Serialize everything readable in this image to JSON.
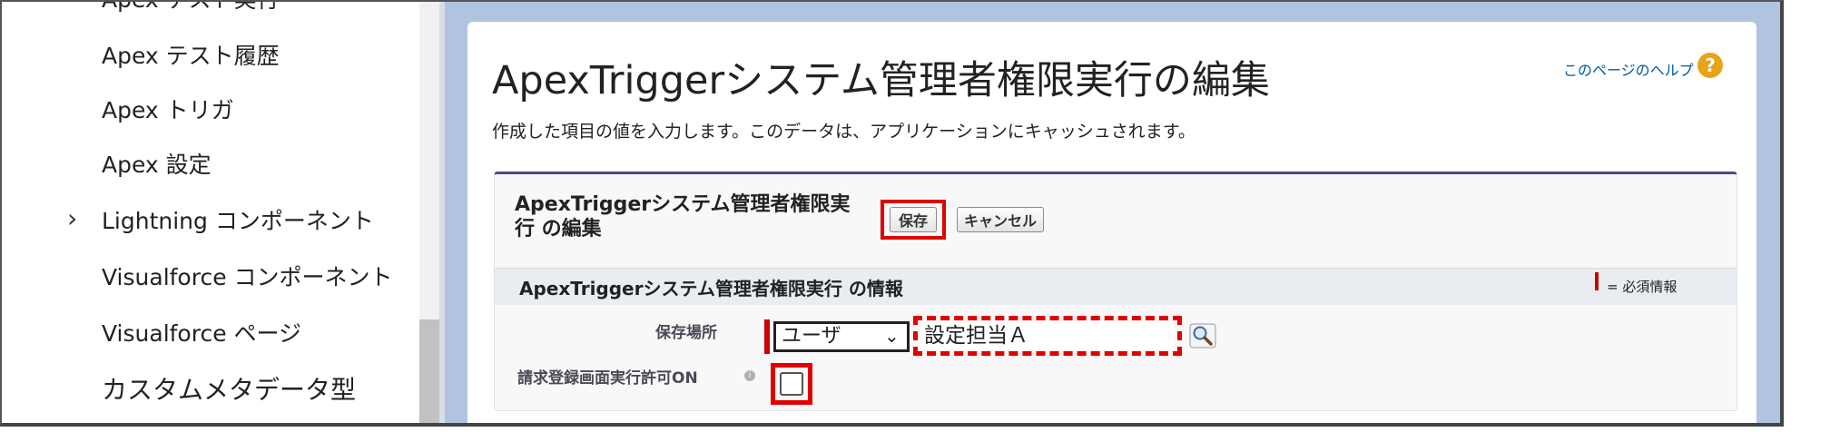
{
  "sidebar": {
    "partial_item": "Apex テスト実行",
    "items": [
      {
        "label": "Apex テスト履歴"
      },
      {
        "label": "Apex トリガ"
      },
      {
        "label": "Apex 設定"
      },
      {
        "label": "Lightning コンポーネント",
        "expandable": true
      },
      {
        "label": "Visualforce コンポーネント"
      },
      {
        "label": "Visualforce ページ"
      },
      {
        "label": "カスタムメタデータ型"
      }
    ]
  },
  "page": {
    "title": "ApexTriggerシステム管理者権限実行の編集",
    "help_link": "このページのヘルプ",
    "help_icon": "question-icon",
    "description": "作成した項目の値を入力します。このデータは、アプリケーションにキャッシュされます。"
  },
  "edit_block": {
    "title": "ApexTriggerシステム管理者権限実行 の編集",
    "save_label": "保存",
    "cancel_label": "キャンセル"
  },
  "section": {
    "title": "ApexTriggerシステム管理者権限実行 の情報",
    "required_legend": "= 必須情報"
  },
  "fields": {
    "location_label": "保存場所",
    "location_type": "ユーザ",
    "location_value": "設定担当Ａ",
    "approve_label": "請求登録画面実行許可ON",
    "approve_checked": false
  },
  "colors": {
    "highlight": "#e00000",
    "required": "#cc0000",
    "background": "#b0c4df"
  }
}
